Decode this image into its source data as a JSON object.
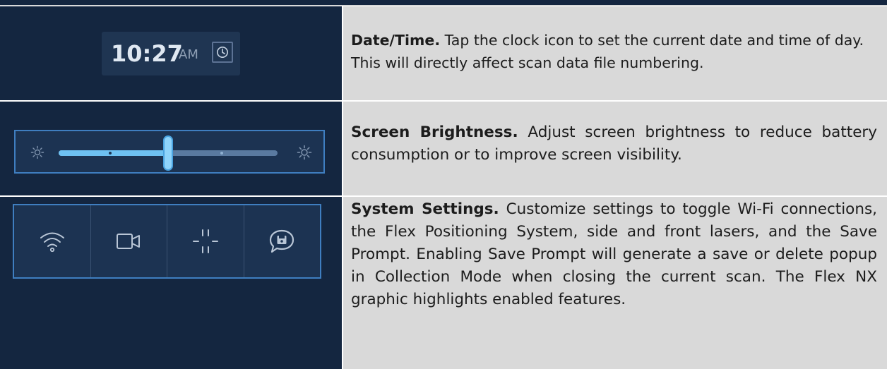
{
  "rows": [
    {
      "title": "Date/Time.",
      "text": "Tap the clock icon to set the current date and time of day. This will directly affect scan data file numbering.",
      "widget": {
        "time": "10:27",
        "ampm": "AM",
        "icon": "clock-icon"
      }
    },
    {
      "title": "Screen Brightness.",
      "text": "Adjust screen brightness to reduce battery consumption or to improve screen visibility.",
      "widget": {
        "level": 0.5,
        "left_icon": "brightness-low-icon",
        "right_icon": "brightness-high-icon"
      }
    },
    {
      "title": "System Settings.",
      "text": "Customize settings to toggle Wi-Fi connections, the Flex Positioning System, side and front lasers, and the Save Prompt. Enabling Save Prompt will generate a save or delete popup in Collection Mode when closing the current scan. The Flex NX graphic highlights enabled features.",
      "widget": {
        "buttons": [
          "wifi-icon",
          "camera-icon",
          "laser-crosshair-icon",
          "save-prompt-icon"
        ]
      }
    }
  ],
  "colors": {
    "panel_dark": "#142640",
    "panel_light": "#d9d9d9",
    "accent": "#3f7ec0",
    "slider_fill": "#6ec1f2"
  }
}
